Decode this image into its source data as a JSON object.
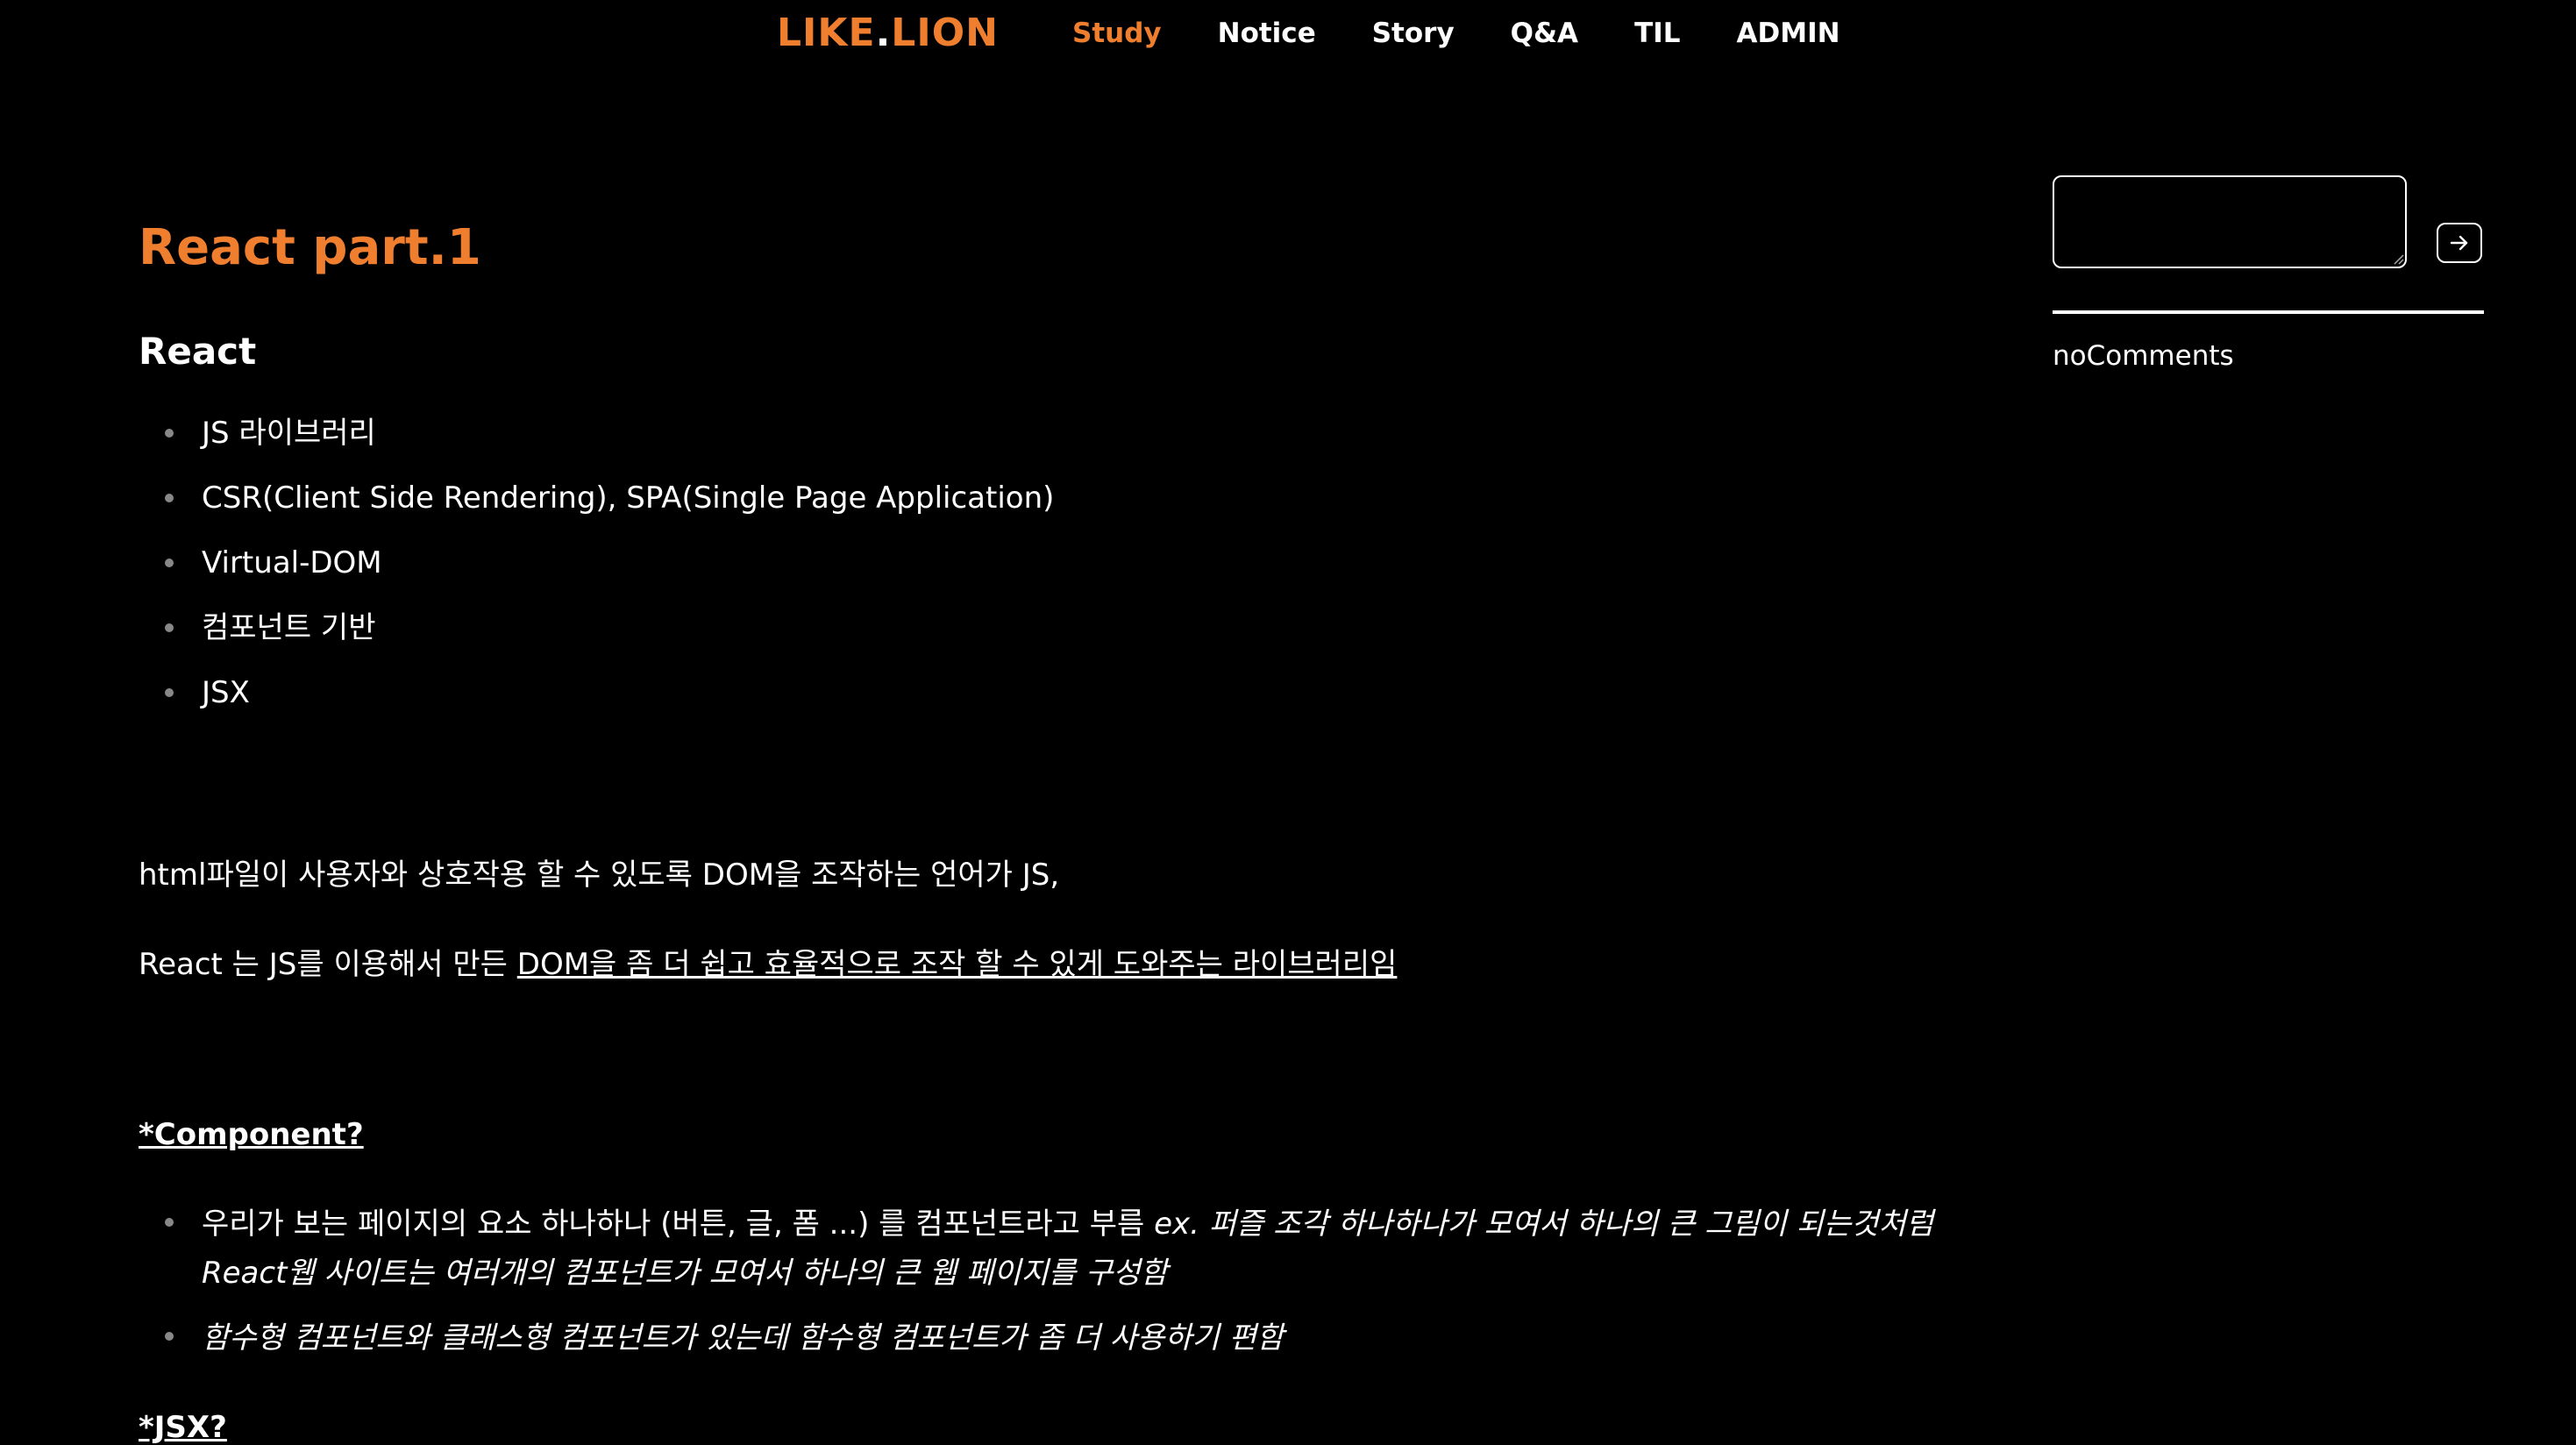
{
  "header": {
    "logo_main": "LIKE",
    "logo_dot": ".",
    "logo_end": "LION",
    "nav": [
      {
        "label": "Study",
        "active": true
      },
      {
        "label": "Notice",
        "active": false
      },
      {
        "label": "Story",
        "active": false
      },
      {
        "label": "Q&A",
        "active": false
      },
      {
        "label": "TIL",
        "active": false
      },
      {
        "label": "ADMIN",
        "active": false
      }
    ]
  },
  "post": {
    "title": "React part.1",
    "section_react": "React",
    "react_items": [
      "JS 라이브러리",
      "CSR(Client Side Rendering), SPA(Single Page Application)",
      "Virtual-DOM",
      "컴포넌트 기반",
      "JSX"
    ],
    "para1": "html파일이 사용자와 상호작용 할 수 있도록 DOM을 조작하는 언어가 JS,",
    "para2_plain": "React 는 JS를 이용해서 만든 ",
    "para2_underlined": "DOM을 좀 더 쉽고 효율적으로 조작 할 수 있게 도와주는 라이브러리임",
    "component_heading": "*Component?",
    "component_item1_plain": "우리가 보는 페이지의 요소 하나하나 (버튼, 글, 폼 ...) 를 컴포넌트라고 부름 ",
    "component_item1_italic_line1": "ex. 퍼즐 조각 하나하나가 모여서 하나의 큰 그림이 되는것처럼",
    "component_item1_italic_line2": "React웹 사이트는 여러개의 컴포넌트가 모여서 하나의 큰 웹 페이지를 구성함",
    "component_item2": "함수형 컴포넌트와 클래스형 컴포넌트가 있는데 함수형 컴포넌트가 좀 더 사용하기 편함",
    "jsx_heading": "*JSX?"
  },
  "comments": {
    "input_value": "",
    "submit_icon": "arrow-right-icon",
    "empty_text": "noComments"
  },
  "colors": {
    "accent": "#ef7f2f",
    "background": "#000000",
    "text": "#ffffff",
    "bullet": "#888888"
  }
}
